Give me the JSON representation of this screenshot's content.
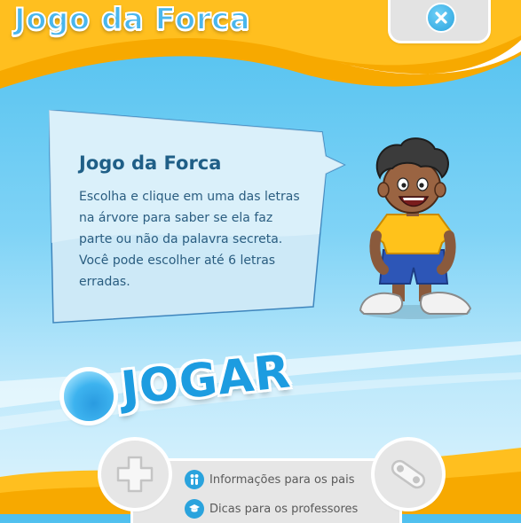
{
  "header": {
    "title": "Jogo da Forca",
    "close_icon": "close-x-icon"
  },
  "info": {
    "title": "Jogo da Forca",
    "text": "Escolha e clique em uma das letras na árvore para saber se ela faz parte ou não da palavra secreta. Você pode escolher até 6 letras erradas."
  },
  "play": {
    "label": "JOGAR"
  },
  "footer": {
    "left_icon": "gamepad-icon",
    "right_icon": "controller-icon",
    "links": [
      {
        "label": "Informações para os pais",
        "icon": "parents-icon"
      },
      {
        "label": "Dicas para os professores",
        "icon": "graduation-cap-icon"
      }
    ]
  },
  "colors": {
    "sky": "#4fc0ef",
    "orange": "#f8a800",
    "accent_blue": "#2aa3dd",
    "panel_gray": "#e6e6e6"
  }
}
